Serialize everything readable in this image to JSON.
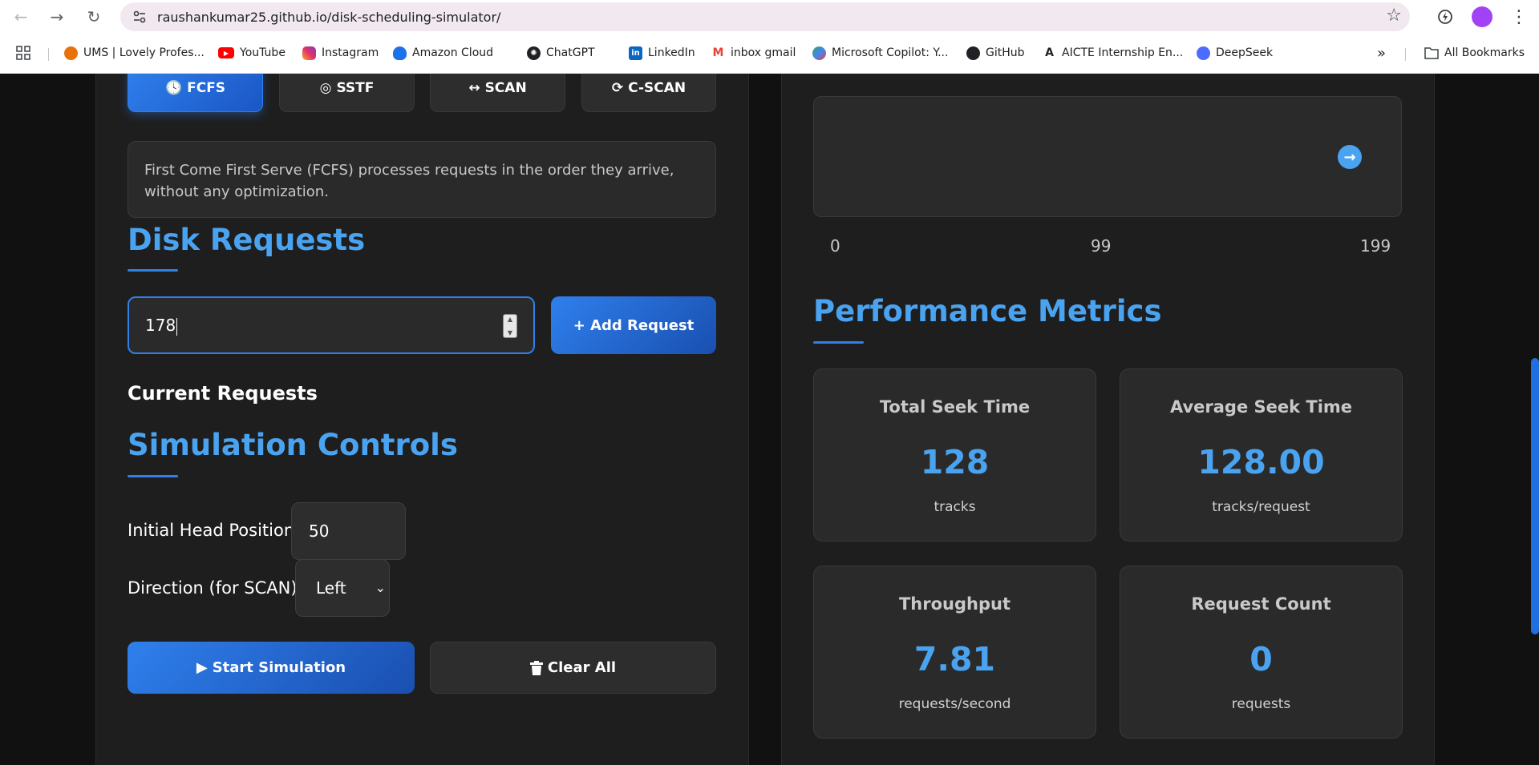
{
  "browser": {
    "url": "raushankumar25.github.io/disk-scheduling-simulator/",
    "bookmarks": [
      {
        "label": "UMS | Lovely Profes...",
        "icon": "ums-icon"
      },
      {
        "label": "YouTube",
        "icon": "youtube-icon"
      },
      {
        "label": "Instagram",
        "icon": "instagram-icon"
      },
      {
        "label": "Amazon Cloud",
        "icon": "amazon-cloud-icon"
      },
      {
        "label": "ChatGPT",
        "icon": "chatgpt-icon"
      },
      {
        "label": "LinkedIn",
        "icon": "linkedin-icon"
      },
      {
        "label": "inbox gmail",
        "icon": "gmail-icon"
      },
      {
        "label": "Microsoft Copilot: Y...",
        "icon": "copilot-icon"
      },
      {
        "label": "GitHub",
        "icon": "github-icon"
      },
      {
        "label": "AICTE Internship En...",
        "icon": "aicte-icon"
      },
      {
        "label": "DeepSeek",
        "icon": "deepseek-icon"
      }
    ],
    "more_bookmarks": "»",
    "all_bookmarks": "All Bookmarks"
  },
  "algorithms": {
    "tabs": [
      {
        "label": "FCFS",
        "icon": "clock-icon",
        "glyph": "🕓",
        "active": true
      },
      {
        "label": "SSTF",
        "icon": "target-icon",
        "glyph": "◎",
        "active": false
      },
      {
        "label": "SCAN",
        "icon": "arrows-horizontal-icon",
        "glyph": "↔",
        "active": false
      },
      {
        "label": "C-SCAN",
        "icon": "sync-icon",
        "glyph": "⟳",
        "active": false
      }
    ],
    "description": "First Come First Serve (FCFS) processes requests in the order they arrive, without any optimization."
  },
  "disk_requests": {
    "title": "Disk Requests",
    "input_value": "178",
    "add_button": "+ Add Request",
    "current_requests_heading": "Current Requests"
  },
  "simulation_controls": {
    "title": "Simulation Controls",
    "head_label": "Initial Head Position:",
    "head_value": "50",
    "direction_label": "Direction (for SCAN):",
    "direction_value": "Left",
    "start_button": "Start Simulation",
    "clear_button": "Clear All"
  },
  "visualization": {
    "scale": [
      "0",
      "99",
      "199"
    ]
  },
  "metrics": {
    "title": "Performance Metrics",
    "cards": [
      {
        "title": "Total Seek Time",
        "value": "128",
        "unit": "tracks"
      },
      {
        "title": "Average Seek Time",
        "value": "128.00",
        "unit": "tracks/request"
      },
      {
        "title": "Throughput",
        "value": "7.81",
        "unit": "requests/second"
      },
      {
        "title": "Request Count",
        "value": "0",
        "unit": "requests"
      }
    ]
  },
  "colors": {
    "accent": "#2f80ed",
    "heading": "#4aa3f0",
    "background": "#111111",
    "panel": "#1e1e1e"
  }
}
